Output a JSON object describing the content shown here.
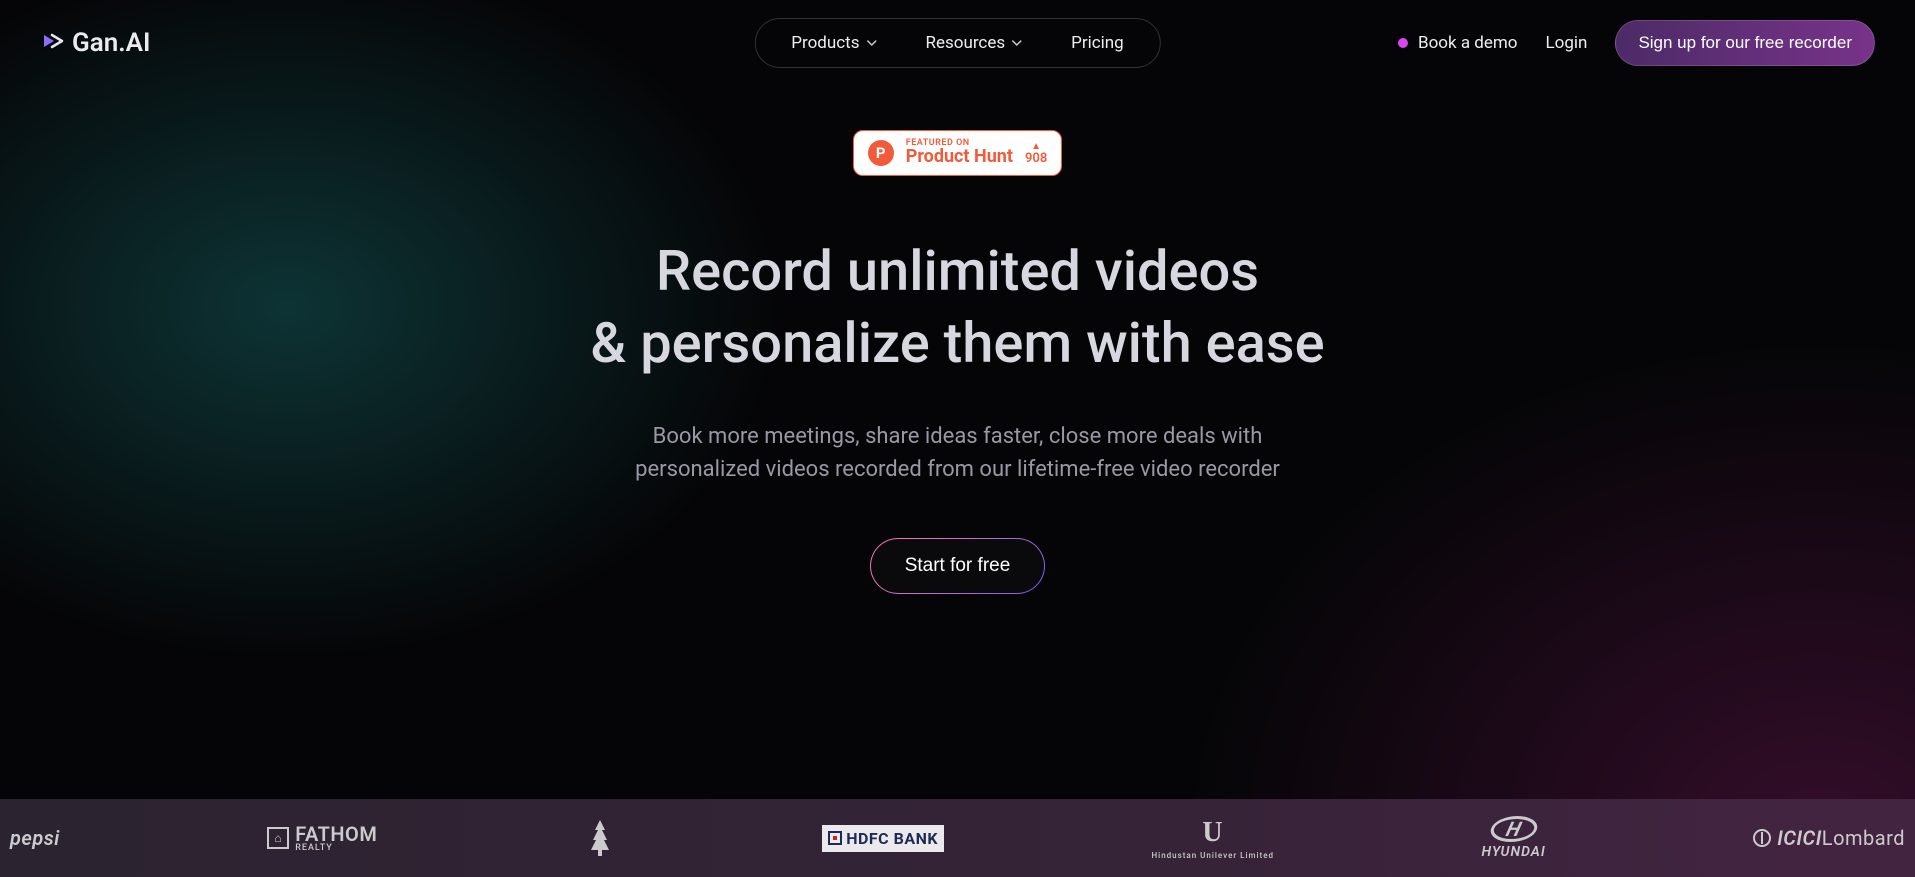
{
  "brand": {
    "name": "Gan.AI"
  },
  "nav": {
    "products": "Products",
    "resources": "Resources",
    "pricing": "Pricing"
  },
  "header_actions": {
    "book_demo": "Book a demo",
    "login": "Login",
    "signup": "Sign up for our free recorder"
  },
  "product_hunt": {
    "featured": "FEATURED ON",
    "name": "Product Hunt",
    "count": "908"
  },
  "hero": {
    "headline_line1": "Record unlimited videos",
    "headline_line2": "& personalize them with ease",
    "subhead_line1": "Book more meetings, share ideas faster, close more deals with",
    "subhead_line2": "personalized videos recorded from our lifetime-free video recorder",
    "cta": "Start for free"
  },
  "logo_strip": {
    "pepsi": "pepsi",
    "fathom": "FATHOM",
    "fathom_sub": "REALTY",
    "hdfc": "HDFC BANK",
    "unilever_sub": "Hindustan Unilever Limited",
    "hyundai": "HYUNDAI",
    "icici": "ICICI",
    "icici_suffix": "Lombard"
  }
}
